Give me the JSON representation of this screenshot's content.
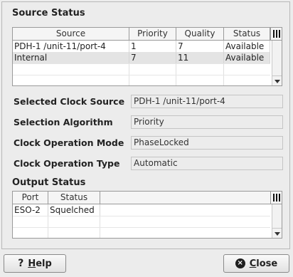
{
  "source_status": {
    "title": "Source Status",
    "columns": [
      "Source",
      "Priority",
      "Quality",
      "Status"
    ],
    "rows": [
      {
        "source": "PDH-1 /unit-11/port-4",
        "priority": "1",
        "quality": "7",
        "status": "Available"
      },
      {
        "source": "Internal",
        "priority": "7",
        "quality": "11",
        "status": "Available"
      }
    ]
  },
  "fields": {
    "selected_clock_source": {
      "label": "Selected Clock Source",
      "value": "PDH-1 /unit-11/port-4"
    },
    "selection_algorithm": {
      "label": "Selection Algorithm",
      "value": "Priority"
    },
    "clock_operation_mode": {
      "label": "Clock Operation Mode",
      "value": "PhaseLocked"
    },
    "clock_operation_type": {
      "label": "Clock Operation Type",
      "value": "Automatic"
    }
  },
  "output_status": {
    "title": "Output Status",
    "columns": [
      "Port",
      "Status"
    ],
    "rows": [
      {
        "port": "ESO-2",
        "status": "Squelched"
      }
    ]
  },
  "buttons": {
    "help": {
      "prefix": "",
      "mnemonic": "H",
      "rest": "elp",
      "icon": "?"
    },
    "close": {
      "mnemonic": "C",
      "rest": "lose",
      "icon": "×"
    }
  }
}
